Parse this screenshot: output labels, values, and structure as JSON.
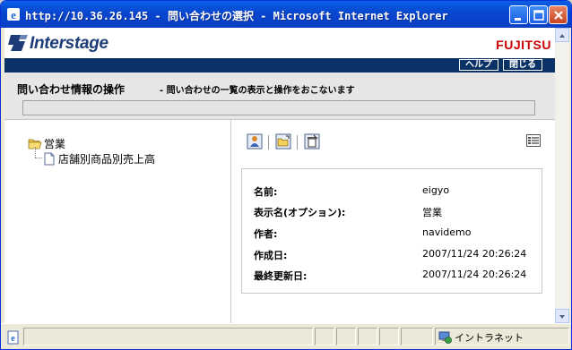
{
  "window": {
    "title": "http://10.36.26.145 - 問い合わせの選択 - Microsoft Internet Explorer",
    "icon": "ie-icon"
  },
  "header": {
    "logo_text": "Interstage",
    "brand": "FUJITSU"
  },
  "nav": {
    "help": "ヘルプ",
    "close": "閉じる"
  },
  "operation": {
    "title": "問い合わせ情報の操作",
    "description": "- 問い合わせの一覧の表示と操作をおこないます"
  },
  "tree": {
    "root_label": "営業",
    "child_label": "店舗別商品別売上高"
  },
  "properties": {
    "name_label": "名前:",
    "name_value": "eigyo",
    "display_label": "表示名(オプション):",
    "display_value": "営業",
    "author_label": "作者:",
    "author_value": "navidemo",
    "created_label": "作成日:",
    "created_value": "2007/11/24 20:26:24",
    "updated_label": "最終更新日:",
    "updated_value": "2007/11/24 20:26:24"
  },
  "status": {
    "zone": "イントラネット"
  },
  "colors": {
    "titlebar": "#0846cf",
    "navbar": "#0a3266",
    "brand": "#cc0000",
    "logo": "#1c3b78"
  }
}
